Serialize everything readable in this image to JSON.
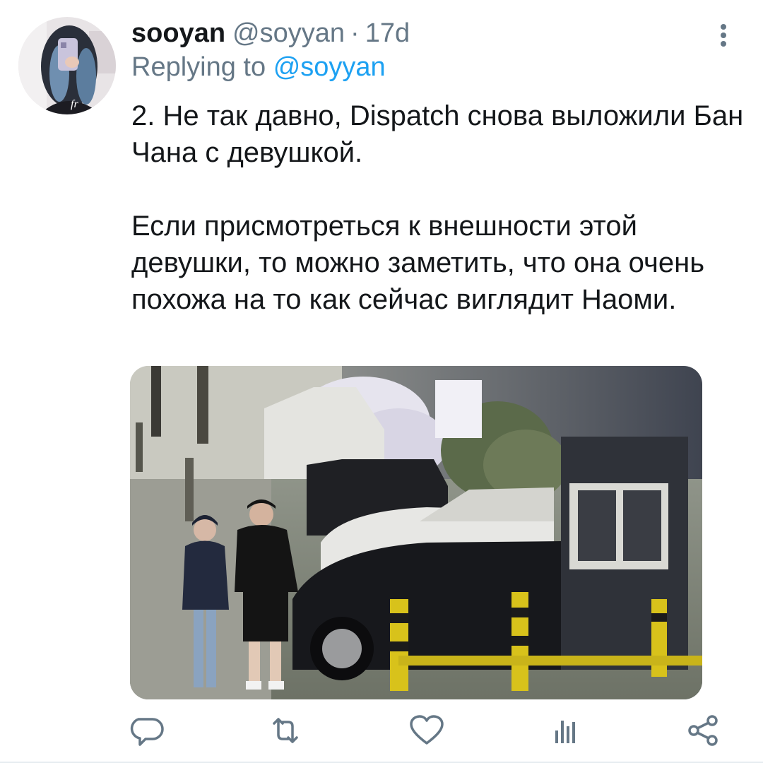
{
  "tweet": {
    "author": {
      "display_name": "sooyan",
      "handle": "@soyyan",
      "avatar_icon": "user-avatar-photo"
    },
    "separator": "·",
    "time": "17d",
    "reply": {
      "prefix": "Replying to",
      "mention": "@soyyan"
    },
    "text": [
      "2. Не так давно, Dispatch снова выложили Бан Чана с девушкой.",
      "Если присмотреться к внешности этой девушки, то можно заметить, что она очень похожа на то как сейчас виглядит Наоми."
    ],
    "media_icon": "street-photo-couple-walking"
  },
  "actions": [
    {
      "name": "reply",
      "icon": "reply-bubble-icon"
    },
    {
      "name": "retweet",
      "icon": "retweet-icon"
    },
    {
      "name": "like",
      "icon": "heart-icon"
    },
    {
      "name": "analytics",
      "icon": "bar-chart-icon"
    },
    {
      "name": "share",
      "icon": "share-icon"
    }
  ],
  "colors": {
    "name": "#14171a",
    "secondary": "#657786",
    "mention": "#1da1f2",
    "icon": "#657786"
  }
}
